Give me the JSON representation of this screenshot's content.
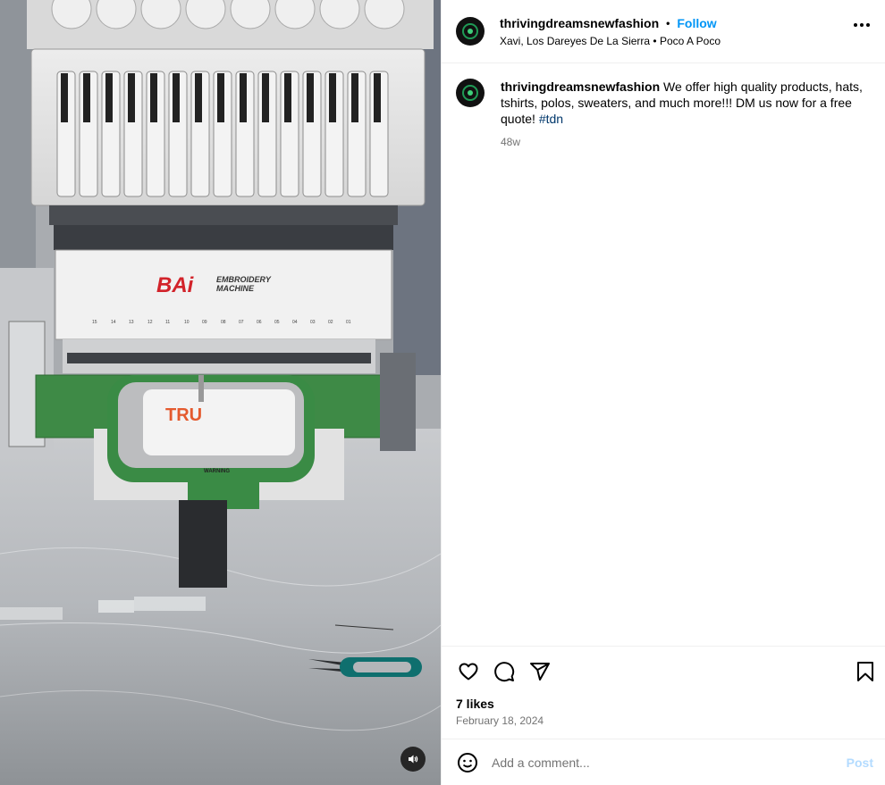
{
  "post": {
    "username": "thrivingdreamsnewfashion",
    "follow_label": "Follow",
    "audio": "Xavi, Los Dareyes De La Sierra • Poco A Poco",
    "caption_text": "We offer high quality products, hats, tshirts, polos, sweaters, and much more!!! DM us now for a free quote! ",
    "hashtag": "#tdn",
    "age": "48w",
    "likes": "7 likes",
    "date": "February 18, 2024",
    "comment_placeholder": "Add a comment...",
    "post_label": "Post"
  },
  "media": {
    "brand": "BAi",
    "brand_sub1": "EMBROIDERY",
    "brand_sub2": "MACHINE",
    "embroidery_text": "TRU",
    "needle_numbers": [
      "15",
      "14",
      "13",
      "12",
      "11",
      "10",
      "09",
      "08",
      "07",
      "06",
      "05",
      "04",
      "03",
      "02",
      "01"
    ],
    "hoop_label": "WARNING"
  },
  "icons": {
    "like": "heart-icon",
    "comment": "comment-icon",
    "share": "share-icon",
    "save": "bookmark-icon",
    "emoji": "emoji-icon",
    "more": "more-options-icon",
    "audio": "speaker-icon"
  },
  "colors": {
    "accent": "#0095f6",
    "hashtag": "#00376b",
    "muted": "#737373",
    "post_disabled": "#b3dbff"
  }
}
